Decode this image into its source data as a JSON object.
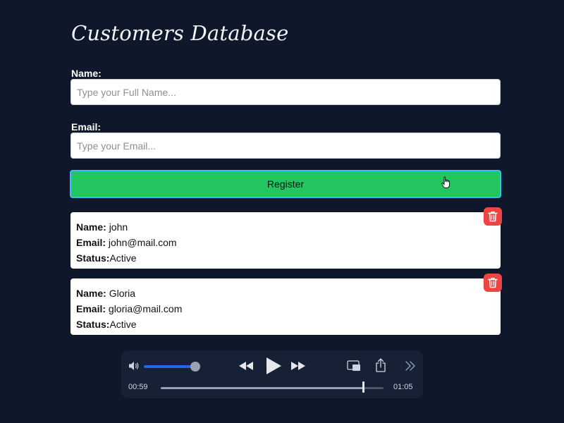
{
  "page": {
    "title": "Customers Database"
  },
  "form": {
    "name_label": "Name:",
    "name_placeholder": "Type your Full Name...",
    "name_value": "",
    "email_label": "Email:",
    "email_placeholder": "Type your Email...",
    "email_value": "",
    "register_label": "Register"
  },
  "customers": [
    {
      "name_label": "Name:",
      "name": "john",
      "email_label": "Email:",
      "email": "john@mail.com",
      "status_label": "Status:",
      "status": "Active"
    },
    {
      "name_label": "Name:",
      "name": "Gloria",
      "email_label": "Email:",
      "email": "gloria@mail.com",
      "status_label": "Status:",
      "status": "Active"
    }
  ],
  "player": {
    "elapsed": "00:59",
    "total": "01:05",
    "progress": 0.9077,
    "volume": 0.86
  },
  "colors": {
    "background": "#0f172a",
    "register": "#22c55e",
    "delete": "#ef4444",
    "volume": "#2563eb"
  }
}
